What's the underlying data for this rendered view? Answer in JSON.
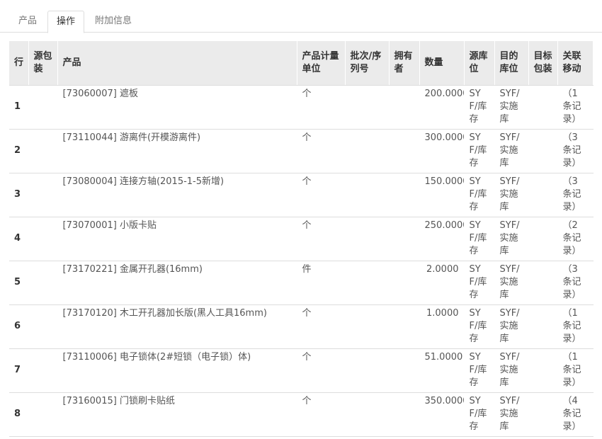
{
  "tabs": [
    {
      "label": "产品"
    },
    {
      "label": "操作"
    },
    {
      "label": "附加信息"
    }
  ],
  "table": {
    "headers": {
      "row": "行",
      "source_package": "源包装",
      "product": "产品",
      "uom": "产品计量单位",
      "lot": "批次/序列号",
      "owner": "拥有者",
      "qty": "数量",
      "source_location": "源库位",
      "dest_location": "目的库位",
      "dest_package": "目标包装",
      "related_moves": "关联移动"
    },
    "rows": [
      {
        "row": "1",
        "product": "[73060007] 遮板",
        "uom": "个",
        "qty": "200.0000",
        "source_location": "SYF/库存",
        "dest_location": "SYF/实施库",
        "related_moves": "（1 条记录）"
      },
      {
        "row": "2",
        "product": "[73110044] 游离件(开模游离件)",
        "uom": "个",
        "qty": "300.0000",
        "source_location": "SYF/库存",
        "dest_location": "SYF/实施库",
        "related_moves": "（3 条记录）"
      },
      {
        "row": "3",
        "product": "[73080004] 连接方轴(2015-1-5新增)",
        "uom": "个",
        "qty": "150.0000",
        "source_location": "SYF/库存",
        "dest_location": "SYF/实施库",
        "related_moves": "（3 条记录）"
      },
      {
        "row": "4",
        "product": "[73070001] 小版卡贴",
        "uom": "个",
        "qty": "250.0000",
        "source_location": "SYF/库存",
        "dest_location": "SYF/实施库",
        "related_moves": "（2 条记录）"
      },
      {
        "row": "5",
        "product": "[73170221] 金属开孔器(16mm)",
        "uom": "件",
        "qty": "2.0000",
        "source_location": "SYF/库存",
        "dest_location": "SYF/实施库",
        "related_moves": "（3 条记录）"
      },
      {
        "row": "6",
        "product": "[73170120] 木工开孔器加长版(黑人工具16mm)",
        "uom": "个",
        "qty": "1.0000",
        "source_location": "SYF/库存",
        "dest_location": "SYF/实施库",
        "related_moves": "（1 条记录）"
      },
      {
        "row": "7",
        "product": "[73110006] 电子锁体(2#短锁（电子锁）体)",
        "uom": "个",
        "qty": "51.0000",
        "source_location": "SYF/库存",
        "dest_location": "SYF/实施库",
        "related_moves": "（1 条记录）"
      },
      {
        "row": "8",
        "product": "[73160015] 门锁刷卡贴纸",
        "uom": "个",
        "qty": "350.0000",
        "source_location": "SYF/库存",
        "dest_location": "SYF/实施库",
        "related_moves": "（4 条记录）"
      }
    ]
  }
}
